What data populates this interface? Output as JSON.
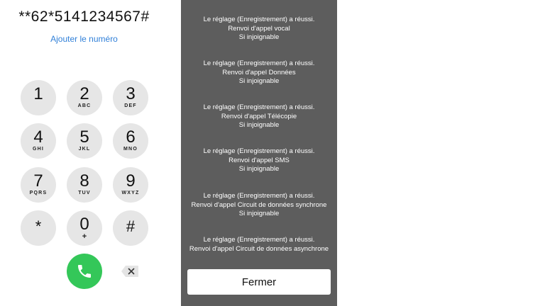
{
  "dialer": {
    "number": "**62*5141234567#",
    "add_number_label": "Ajouter le numéro",
    "keys": [
      {
        "digit": "1",
        "letters": ""
      },
      {
        "digit": "2",
        "letters": "ABC"
      },
      {
        "digit": "3",
        "letters": "DEF"
      },
      {
        "digit": "4",
        "letters": "GHI"
      },
      {
        "digit": "5",
        "letters": "JKL"
      },
      {
        "digit": "6",
        "letters": "MNO"
      },
      {
        "digit": "7",
        "letters": "PQRS"
      },
      {
        "digit": "8",
        "letters": "TUV"
      },
      {
        "digit": "9",
        "letters": "WXYZ"
      },
      {
        "digit": "*",
        "letters": ""
      },
      {
        "digit": "0",
        "letters": "+"
      },
      {
        "digit": "#",
        "letters": ""
      }
    ],
    "call_icon": "phone-icon",
    "delete_icon": "backspace-icon",
    "call_color": "#34c759"
  },
  "dialog": {
    "messages": [
      [
        "Le réglage (Enregistrement) a réussi.",
        "Renvoi d'appel vocal",
        "Si injoignable"
      ],
      [
        "Le réglage (Enregistrement) a réussi.",
        "Renvoi d'appel Données",
        "Si injoignable"
      ],
      [
        "Le réglage (Enregistrement) a réussi.",
        "Renvoi d'appel Télécopie",
        "Si injoignable"
      ],
      [
        "Le réglage (Enregistrement) a réussi.",
        "Renvoi d'appel SMS",
        "Si injoignable"
      ],
      [
        "Le réglage (Enregistrement) a réussi.",
        "Renvoi d'appel Circuit de données synchrone",
        "Si injoignable"
      ],
      [
        "Le réglage (Enregistrement) a réussi.",
        "Renvoi d'appel Circuit de données asynchrone"
      ]
    ],
    "close_label": "Fermer",
    "background": "#5d5d5d"
  }
}
